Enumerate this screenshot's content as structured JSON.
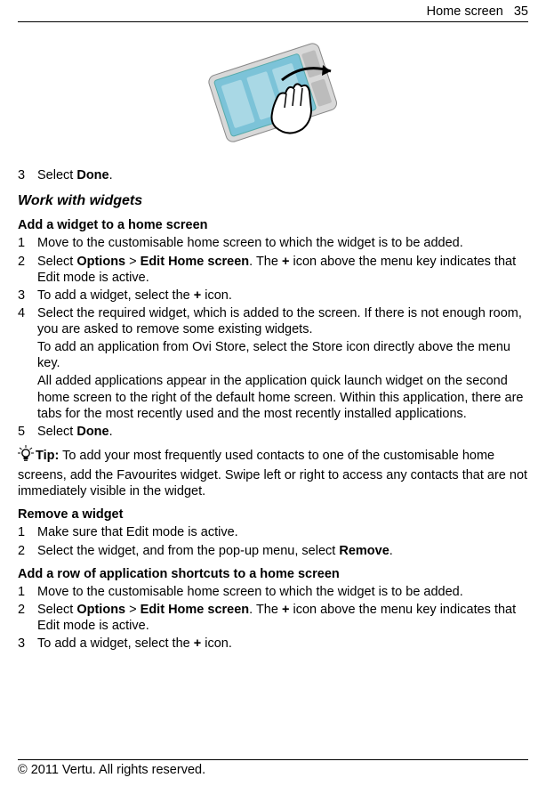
{
  "header": {
    "section": "Home screen",
    "page_number": "35"
  },
  "step3_select": "Select ",
  "done_label": "Done",
  "period": ".",
  "heading_work": "Work with widgets",
  "sub_add_widget": "Add a widget to a home screen",
  "aw": {
    "s1": "Move to the customisable home screen to which the widget is to be added.",
    "s2_a": "Select ",
    "s2_opt": "Options",
    "s2_gt": " > ",
    "s2_edit": "Edit Home screen",
    "s2_b": ". The ",
    "s2_plus": "+",
    "s2_c": " icon above the menu key indicates that Edit mode is active.",
    "s3_a": "To add a widget, select the ",
    "s3_b": " icon.",
    "s4": "Select the required widget, which is added to the screen. If there is not enough room, you are asked to remove some existing widgets.",
    "s4_p1": "To add an application from Ovi Store, select the Store icon directly above the menu key.",
    "s4_p2": "All added applications appear in the application quick launch widget on the second home screen to the right of the default home screen. Within this application, there are tabs for the most recently used and the most recently installed applications.",
    "s5_a": "Select ",
    "s5_done": "Done"
  },
  "tip": {
    "label": "Tip:",
    "text": " To add your most frequently used contacts to one of the customisable home screens, add the Favourites widget. Swipe left or right to access any contacts that are not immediately visible in the widget."
  },
  "sub_remove": "Remove a widget",
  "rw": {
    "s1": "Make sure that Edit mode is active.",
    "s2_a": "Select the widget, and from the pop-up menu, select ",
    "s2_remove": "Remove"
  },
  "sub_row": "Add a row of application shortcuts to a home screen",
  "ar": {
    "s1": "Move to the customisable home screen to which the widget is to be added.",
    "s2_a": "Select ",
    "s2_opt": "Options",
    "s2_gt": " > ",
    "s2_edit": "Edit Home screen",
    "s2_b": ". The ",
    "s2_plus": "+",
    "s2_c": " icon above the menu key indicates that Edit mode is active.",
    "s3_a": "To add a widget, select the ",
    "s3_b": " icon."
  },
  "footer": "© 2011 Vertu. All rights reserved.",
  "n1": "1",
  "n2": "2",
  "n3": "3",
  "n4": "4",
  "n5": "5"
}
